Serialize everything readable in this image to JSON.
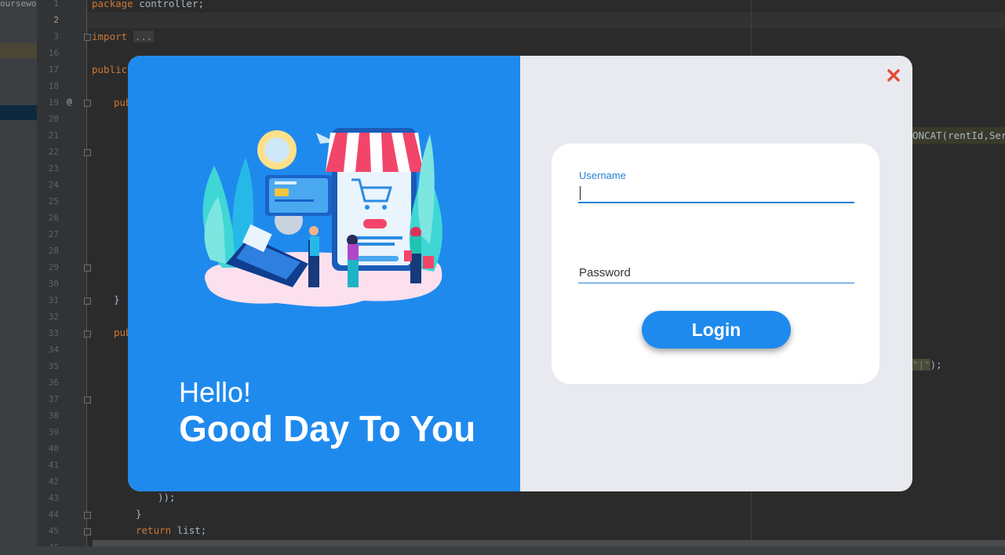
{
  "ide": {
    "project_label": "ourseworl",
    "line_numbers": [
      "1",
      "2",
      "3",
      "16",
      "17",
      "18",
      "19",
      "20",
      "21",
      "22",
      "23",
      "24",
      "25",
      "26",
      "27",
      "28",
      "29",
      "30",
      "31",
      "32",
      "33",
      "34",
      "35",
      "36",
      "37",
      "38",
      "39",
      "40",
      "41",
      "42",
      "43",
      "44",
      "45",
      "46"
    ],
    "current_line": "2",
    "code": {
      "l1_kw": "package",
      "l1_rest": " controller;",
      "l3_kw": "import",
      "l3_fold": "...",
      "l17_kw": "public",
      "l19_kw": "pub",
      "l31": "}",
      "l33_kw": "pub",
      "l43": "));",
      "l44": "}",
      "l45_kw": "return",
      "l45_rest": " list;",
      "l46": "}"
    },
    "concat_text": "ONCAT(rentId,Seri",
    "string_tail_quote": "\"|\"",
    "string_tail_rest": ");",
    "gutter_at": "@"
  },
  "dialog": {
    "greeting_small": "Hello!",
    "greeting_large": "Good Day To You",
    "close_icon": "close-icon",
    "username_label": "Username",
    "username_value": "",
    "password_placeholder": "Password",
    "login_label": "Login"
  },
  "colors": {
    "accent": "#1f8aee",
    "close": "#e74c3c",
    "panel": "#e9eaf0"
  }
}
